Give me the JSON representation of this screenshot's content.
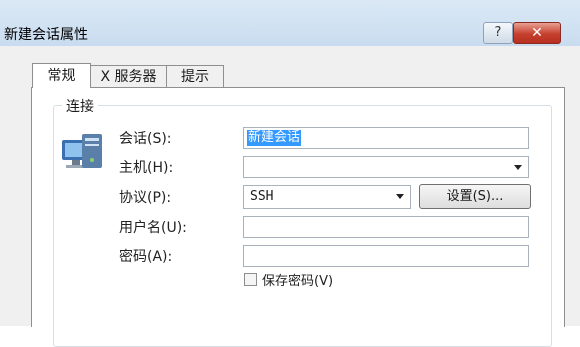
{
  "window": {
    "title": "新建会话属性",
    "help_label": "?",
    "close_label": "✕"
  },
  "tabs": [
    {
      "label": "常规",
      "active": true
    },
    {
      "label": "X 服务器",
      "active": false
    },
    {
      "label": "提示",
      "active": false
    }
  ],
  "group": {
    "title": "连接"
  },
  "form": {
    "session_label": "会话(S):",
    "session_value": "新建会话",
    "host_label": "主机(H):",
    "host_value": "",
    "protocol_label": "协议(P):",
    "protocol_value": "SSH",
    "settings_button": "设置(S)...",
    "username_label": "用户名(U):",
    "username_value": "",
    "password_label": "密码(A):",
    "password_value": "",
    "save_password_label": "保存密码(V)",
    "save_password_checked": false
  },
  "icons": {
    "computer": "computer-icon",
    "dropdown": "chevron-down-icon"
  }
}
